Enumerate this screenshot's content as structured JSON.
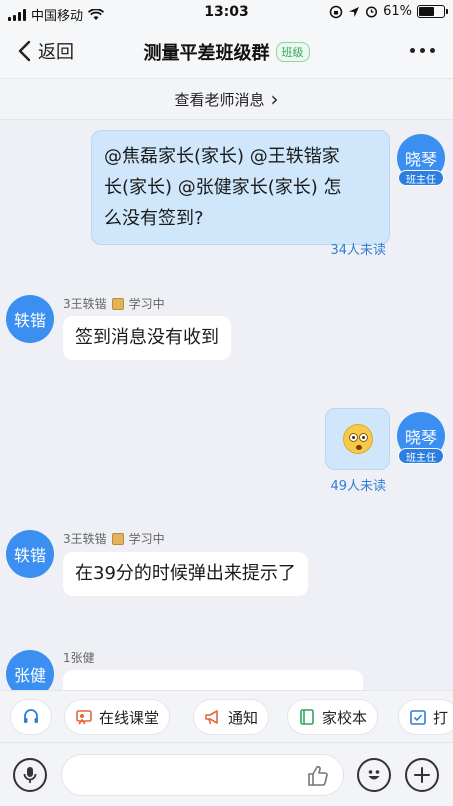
{
  "status_bar": {
    "carrier": "中国移动",
    "time": "13:03",
    "battery": "61%",
    "battery_level": 0.61
  },
  "nav": {
    "back_label": "返回",
    "title": "测量平差班级群",
    "badge": "班级",
    "more_icon": "more-dots-icon"
  },
  "teacher_bar": {
    "label": "查看老师消息",
    "chevron": "›"
  },
  "messages": [
    {
      "side": "me",
      "avatar": "晓琴",
      "role": "班主任",
      "text": "@焦磊家长(家长) @王轶锴家长(家长) @张健家长(家长) 怎么没有签到?",
      "lines": [
        "@焦磊家长(家长) @王轶锴家",
        "长(家长) @张健家长(家长) 怎",
        "么没有签到?"
      ],
      "unread": "34人未读"
    },
    {
      "side": "other",
      "avatar": "轶锴",
      "sender": "3王轶锴",
      "status": "学习中",
      "text": "签到消息没有收到"
    },
    {
      "side": "me",
      "avatar": "晓琴",
      "role": "班主任",
      "emoji": "flushed-face",
      "unread": "49人未读"
    },
    {
      "side": "other",
      "avatar": "轶锴",
      "sender": "3王轶锴",
      "status": "学习中",
      "text": "在39分的时候弹出来提示了"
    },
    {
      "side": "other",
      "avatar": "张健",
      "sender": "1张健",
      "text": ""
    }
  ],
  "toolbar": {
    "items": [
      {
        "label": "",
        "icon": "headset-icon"
      },
      {
        "label": "在线课堂",
        "icon": "classroom-icon"
      },
      {
        "label": "通知",
        "icon": "megaphone-icon"
      },
      {
        "label": "家校本",
        "icon": "notebook-icon"
      },
      {
        "label": "打",
        "icon": "checkin-icon"
      }
    ]
  },
  "input_bar": {
    "voice_icon": "microphone-icon",
    "like_icon": "thumbs-up-icon",
    "emoji_icon": "emoji-icon",
    "add_icon": "plus-icon"
  }
}
